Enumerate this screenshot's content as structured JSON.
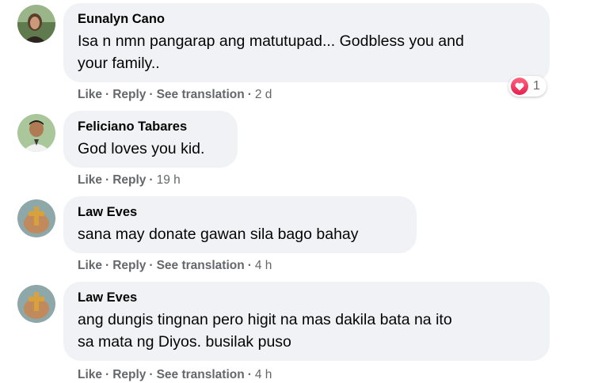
{
  "comments": [
    {
      "author": "Eunalyn Cano",
      "text_lines": [
        "Isa n nmn pangarap ang matutupad... Godbless you and",
        "your family.."
      ],
      "actions": {
        "like": "Like",
        "reply": "Reply",
        "translate": "See translation",
        "time": "2 d"
      },
      "reaction": {
        "icon": "heart-icon",
        "count": "1",
        "color": "#e61e4d"
      },
      "avatar_colors": [
        "#6b8f5e",
        "#3c2b1f"
      ]
    },
    {
      "author": "Feliciano Tabares",
      "text_lines": [
        "God loves you kid."
      ],
      "actions": {
        "like": "Like",
        "reply": "Reply",
        "time": "19 h"
      },
      "avatar_colors": [
        "#7fa36a",
        "#2b2b2b"
      ]
    },
    {
      "author": "Law Eves",
      "text_lines": [
        "sana may donate gawan sila bago bahay"
      ],
      "actions": {
        "like": "Like",
        "reply": "Reply",
        "translate": "See translation",
        "time": "4 h"
      },
      "avatar_colors": [
        "#8ea7a8",
        "#d9a13b"
      ]
    },
    {
      "author": "Law Eves",
      "text_lines": [
        "ang dungis tingnan pero higit na mas dakila bata na ito",
        "sa mata ng Diyos. busilak puso"
      ],
      "actions": {
        "like": "Like",
        "reply": "Reply",
        "translate": "See translation",
        "time": "4 h"
      },
      "avatar_colors": [
        "#8ea7a8",
        "#d9a13b"
      ]
    }
  ],
  "separator": "·",
  "colors": {
    "bubble": "#f0f2f5",
    "meta": "#65676b",
    "text": "#050505"
  }
}
